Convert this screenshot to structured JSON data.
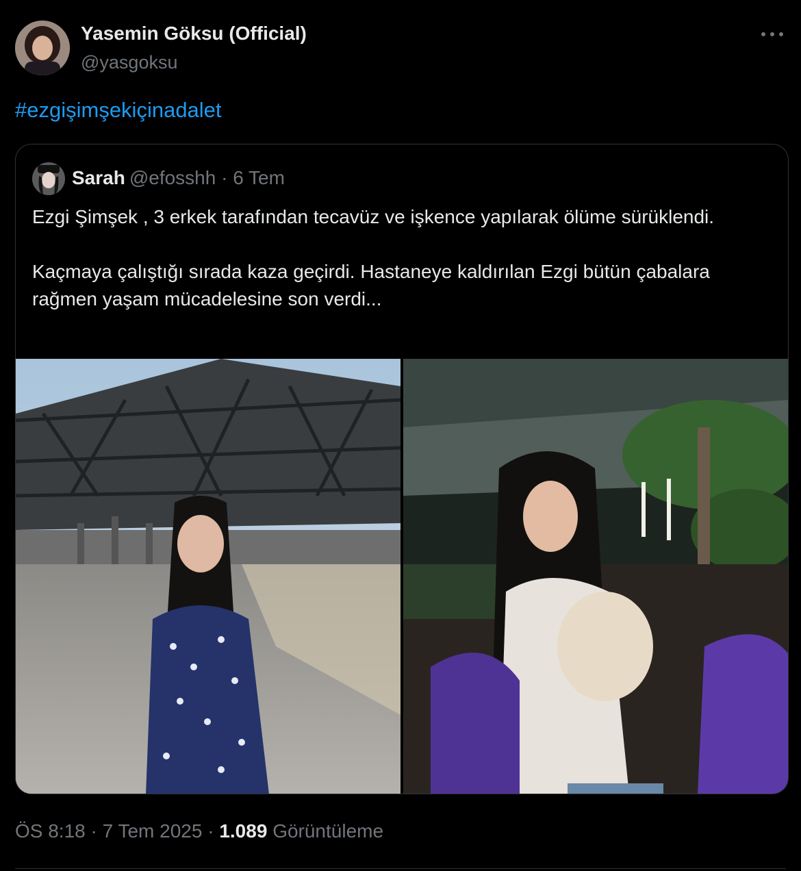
{
  "tweet": {
    "author": {
      "name": "Yasemin Göksu (Official)",
      "handle": "@yasgoksu",
      "avatar_icon": "profile-photo"
    },
    "text": "#ezgişimşekiçinadalet",
    "link_color": "#1d9bf0",
    "quoted": {
      "author_name": "Sarah",
      "meta": "@efosshh · 6 Tem",
      "paragraphs": [
        "Ezgi Şimşek , 3 erkek tarafından tecavüz ve işkence yapılarak ölüme sürüklendi.",
        "Kaçmaya çalıştığı sırada kaza geçirdi. Hastaneye kaldırılan Ezgi bütün çabalara rağmen yaşam mücadelesine son verdi..."
      ],
      "photos": [
        {
          "icon": "photo-girl-under-steel-canopy"
        },
        {
          "icon": "photo-girl-with-puppy-night"
        }
      ]
    },
    "footer": {
      "time": "ÖS 8:18",
      "date": "7 Tem 2025",
      "views": "1.089",
      "views_label": "Görüntüleme"
    }
  }
}
